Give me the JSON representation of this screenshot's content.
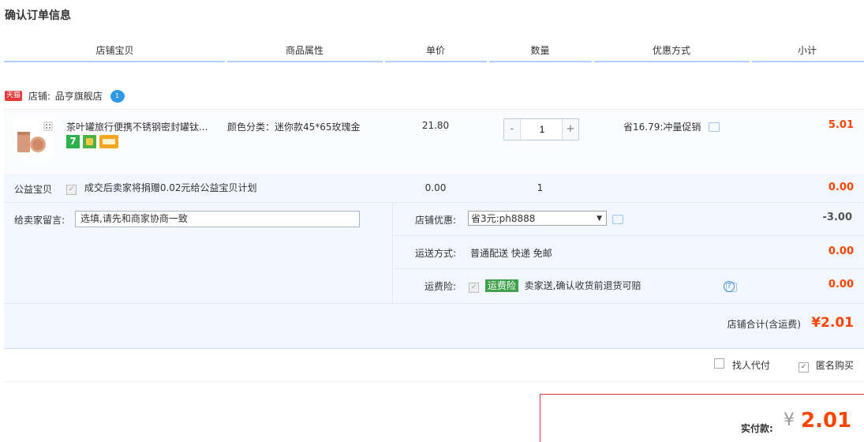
{
  "page_title": "确认订单信息",
  "columns": [
    "店铺宝贝",
    "商品属性",
    "单价",
    "数量",
    "优惠方式",
    "小计"
  ],
  "shop": {
    "tag": "天猫",
    "label": "店铺:",
    "name": "品亨旗舰店",
    "ww_badge": "1"
  },
  "item": {
    "title": "茶叶罐旅行便携不锈钢密封罐钛...",
    "attr": "颜色分类：迷你款45*65玫瑰金",
    "unit_price": "21.80",
    "quantity": "1",
    "minus": "-",
    "plus": "+",
    "promo": "省16.79:冲量促销",
    "subtotal": "5.01",
    "badges": [
      "seven-day-return-icon",
      "golden-service-icon",
      "card-payment-icon"
    ]
  },
  "charity": {
    "label": "公益宝贝",
    "text": "成交后卖家将捐赠0.02元给公益宝贝计划",
    "unit_price": "0.00",
    "quantity": "1",
    "subtotal": "0.00"
  },
  "message": {
    "label": "给卖家留言:",
    "placeholder": "选填,请先和商家协商一致"
  },
  "shop_discount": {
    "label": "店铺优惠:",
    "selected": "省3元:ph8888",
    "amount": "-3.00"
  },
  "shipping": {
    "label": "运送方式:",
    "value": "普通配送 快递 免邮",
    "amount": "0.00"
  },
  "insurance": {
    "label": "运费险:",
    "tag": "运费险",
    "text": "卖家送,确认收货前退货可赔",
    "amount": "0.00"
  },
  "shop_total": {
    "label": "店铺合计(含运费)",
    "value": "¥2.01"
  },
  "options": {
    "proxy_pay": "找人代付",
    "anonymous": "匿名购买"
  },
  "payment": {
    "label": "实付款:",
    "currency": "¥",
    "amount": "2.01"
  },
  "colors": {
    "accent_red": "#ff4400",
    "header_line": "#b2d1ff",
    "light_blue_bg": "#f2f7ff"
  }
}
